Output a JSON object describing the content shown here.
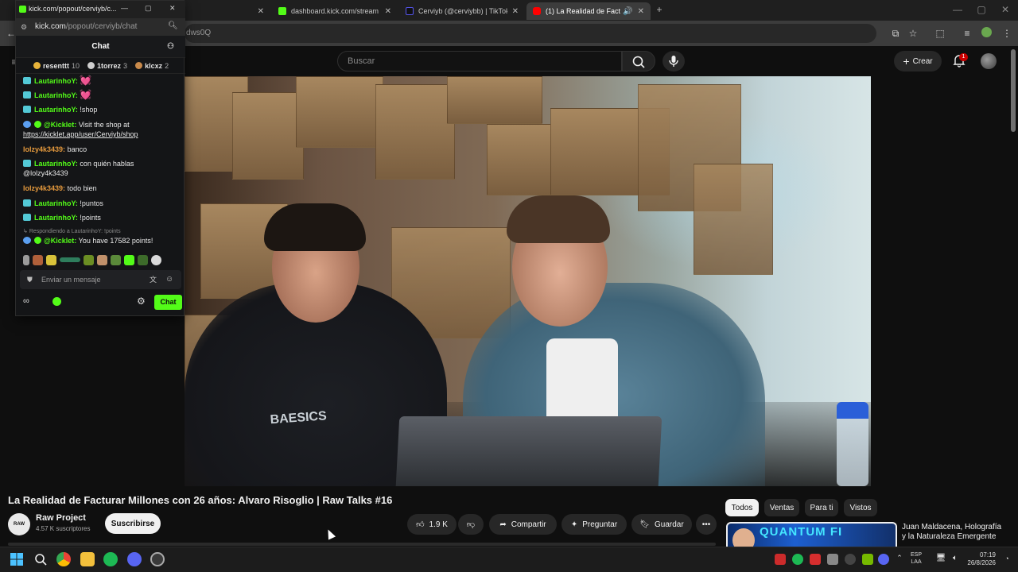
{
  "browser": {
    "tabs": [
      {
        "title": "Cerviyb (@cerviybb) | TikTok",
        "label_hidden": ""
      },
      {
        "title": "dashboard.kick.com/stream"
      },
      {
        "title": "Cerviyb (@cerviybb) | TikTok"
      },
      {
        "title": "(1) La Realidad de Facturar"
      }
    ],
    "address_fragment": "dws0Q"
  },
  "chat_window": {
    "title": "kick.com/popout/cerviyb/c...",
    "url_host": "kick.com",
    "url_path": "/popout/cerviyb/chat",
    "header": "Chat",
    "leaders": [
      {
        "name": "resenttt",
        "count": "10",
        "color": "#e7b33a"
      },
      {
        "name": "1torrez",
        "count": "3",
        "color": "#cfcfcf"
      },
      {
        "name": "klcxz",
        "count": "2",
        "color": "#c98a4b"
      }
    ],
    "messages": [
      {
        "user": "LautarinhoY:",
        "text": "",
        "heart": "💓",
        "user_color": "#53fc18"
      },
      {
        "user": "LautarinhoY:",
        "text": "",
        "heart": "💓",
        "user_color": "#53fc18"
      },
      {
        "user": "LautarinhoY:",
        "text": "!shop",
        "user_color": "#53fc18"
      },
      {
        "user": "@Kicklet:",
        "text": "Visit the shop at",
        "link": "https://kicklet.app/user/Cerviyb/shop",
        "user_color": "#53fc18"
      },
      {
        "user": "lolzy4k3439:",
        "text": "banco",
        "user_color": "#e69a3d"
      },
      {
        "user": "LautarinhoY:",
        "text": "con quién hablas",
        "text2": "@lolzy4k3439",
        "user_color": "#53fc18"
      },
      {
        "user": "lolzy4k3439:",
        "text": "todo bien",
        "user_color": "#e69a3d"
      },
      {
        "user": "LautarinhoY:",
        "text": "!puntos",
        "user_color": "#53fc18"
      },
      {
        "user": "LautarinhoY:",
        "text": "!points",
        "user_color": "#53fc18"
      },
      {
        "reply": "Respondiendo a LautarinhoY: !points"
      },
      {
        "user": "@Kicklet:",
        "text": "You have 17582 points!",
        "user_color": "#53fc18"
      }
    ],
    "input_placeholder": "Enviar un mensaje",
    "send_label": "Chat"
  },
  "youtube": {
    "search_placeholder": "Buscar",
    "create_label": "Crear",
    "notifications_count": "1",
    "video_title": "La Realidad de Facturar Millones con 26 años: Alvaro Risoglio | Raw Talks #16",
    "channel": {
      "avatar_text": "RAW",
      "name": "Raw Project",
      "subscribers": "4.57 K suscriptores"
    },
    "subscribe_label": "Suscribirse",
    "likes": "1.9 K",
    "share_label": "Compartir",
    "ask_label": "Preguntar",
    "save_label": "Guardar",
    "chips": [
      "Todos",
      "Ventas",
      "Para ti",
      "Vistos"
    ],
    "recommended": {
      "thumb_text": "QUANTUM FI",
      "title": "Juan Maldacena, Holografía y la Naturaleza Emergente"
    }
  },
  "taskbar": {
    "lang_top": "ESP",
    "lang_bottom": "LAA",
    "time": "07:19",
    "date": "26/8/2026"
  },
  "colors": {
    "kick_green": "#53fc18",
    "youtube_red": "#ff0000",
    "background": "#0f0f0f"
  }
}
